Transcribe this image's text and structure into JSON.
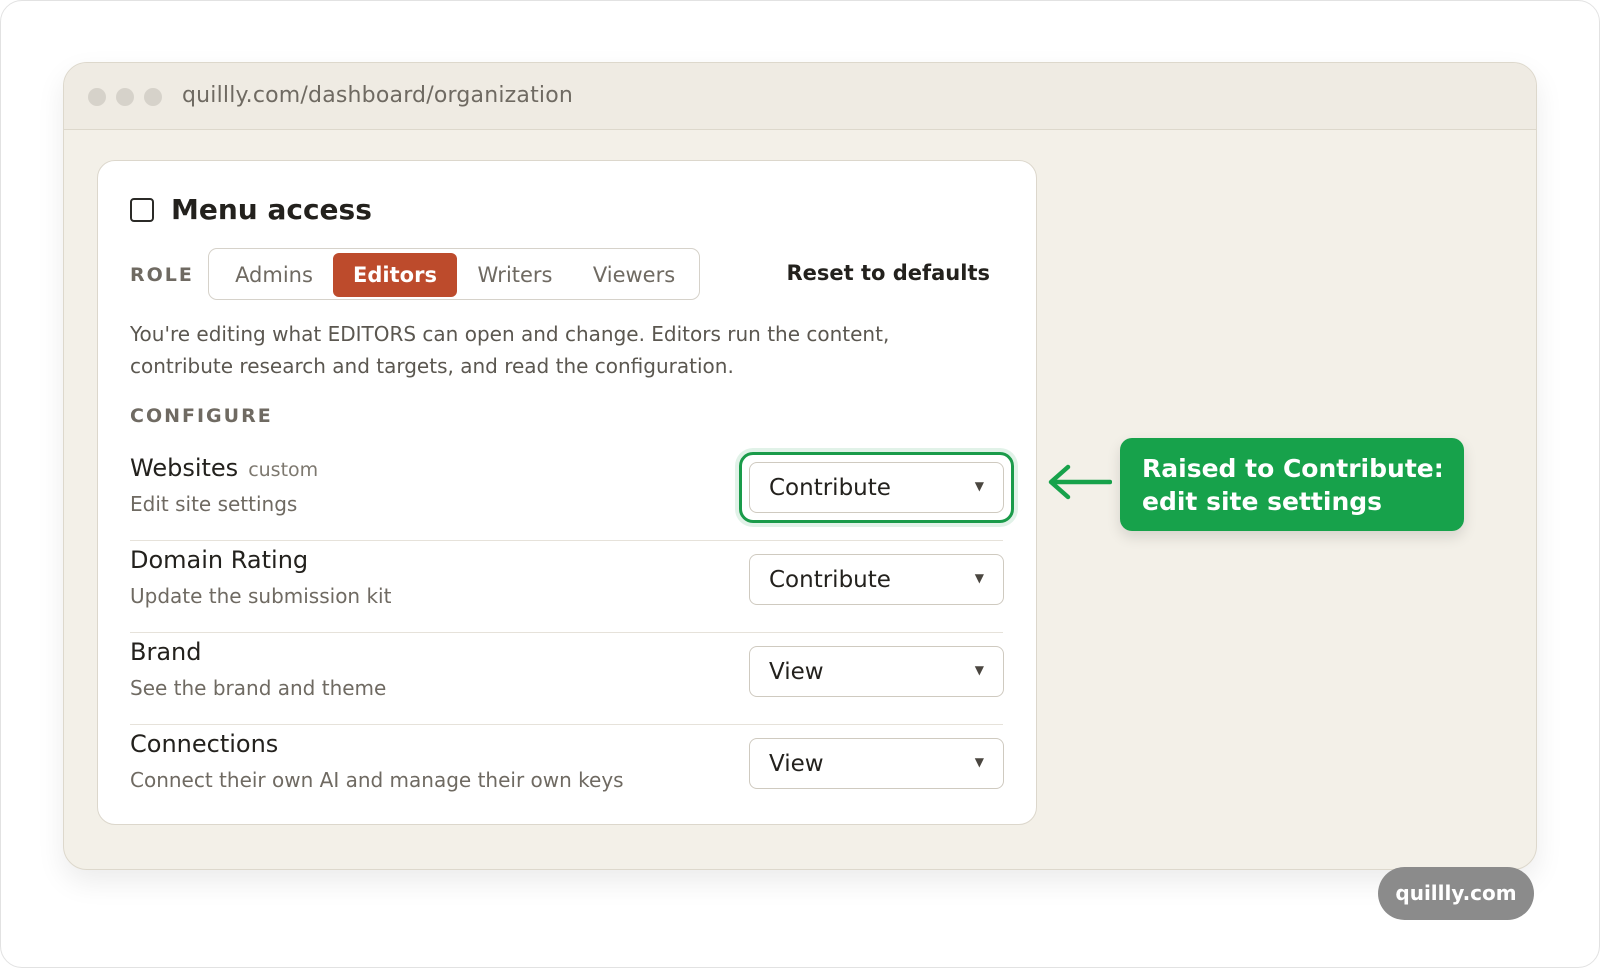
{
  "browser": {
    "url": "quillly.com/dashboard/organization"
  },
  "card": {
    "title": "Menu access",
    "role_label": "ROLE",
    "roles": [
      "Admins",
      "Editors",
      "Writers",
      "Viewers"
    ],
    "active_role": "Editors",
    "reset_label": "Reset to defaults",
    "description": "You're editing what EDITORS can open and change. Editors run the content, contribute research and targets, and read the configuration.",
    "section_label": "CONFIGURE",
    "permissions": [
      {
        "name": "Websites",
        "tag": "custom",
        "sub": "Edit site settings",
        "value": "Contribute"
      },
      {
        "name": "Domain Rating",
        "tag": "",
        "sub": "Update the submission kit",
        "value": "Contribute"
      },
      {
        "name": "Brand",
        "tag": "",
        "sub": "See the brand and theme",
        "value": "View"
      },
      {
        "name": "Connections",
        "tag": "",
        "sub": "Connect their own AI and manage their own keys",
        "value": "View"
      }
    ]
  },
  "callout": {
    "line1": "Raised to Contribute:",
    "line2": "edit site settings"
  },
  "badge": {
    "label": "quillly.com"
  },
  "colors": {
    "accent": "#bd4b2c",
    "highlight": "#17a24b"
  }
}
